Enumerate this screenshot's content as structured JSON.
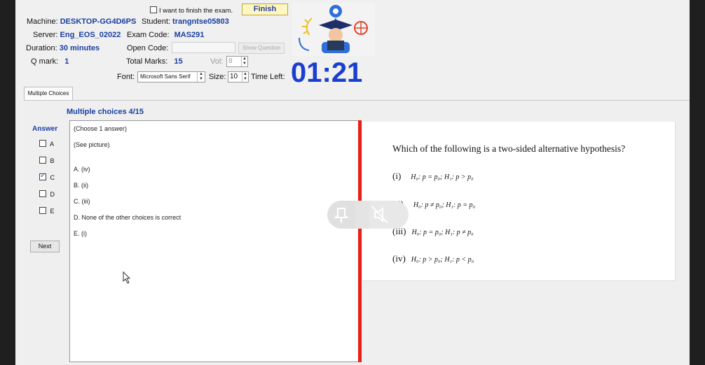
{
  "header": {
    "finish_checkbox_label": "I want to finish the exam.",
    "finish_button": "Finish",
    "machine_label": "Machine:",
    "machine_value": "DESKTOP-GG4D6PS",
    "student_label": "Student:",
    "student_value": "trangntse05803",
    "server_label": "Server:",
    "server_value": "Eng_EOS_02022",
    "exam_code_label": "Exam Code:",
    "exam_code_value": "MAS291",
    "duration_label": "Duration:",
    "duration_value": "30 minutes",
    "open_code_label": "Open Code:",
    "show_question_button": "Show Question",
    "qmark_label": "Q mark:",
    "qmark_value": "1",
    "total_marks_label": "Total Marks:",
    "total_marks_value": "15",
    "vol_label": "Vol:",
    "vol_value": "8",
    "font_label": "Font:",
    "font_value": "Microsoft Sans Serif",
    "size_label": "Size:",
    "size_value": "10",
    "time_left_label": "Time Left:",
    "timer": "01:21"
  },
  "tabs": [
    "Multiple Choices"
  ],
  "question": {
    "title": "Multiple choices 4/15",
    "answer_label": "Answer",
    "options": [
      {
        "letter": "A",
        "checked": false
      },
      {
        "letter": "B",
        "checked": false
      },
      {
        "letter": "C",
        "checked": true
      },
      {
        "letter": "D",
        "checked": false
      },
      {
        "letter": "E",
        "checked": false
      }
    ],
    "next_button": "Next",
    "text_lines": [
      "(Choose 1 answer)",
      "(See picture)",
      "A. (iv)",
      "B. (ii)",
      "C. (iii)",
      "D. None of the other choices is correct",
      "E. (i)"
    ]
  },
  "picture": {
    "question": "Which of the following is a two-sided alternative hypothesis?",
    "items": [
      {
        "num": "(i)",
        "hyp": "H₀: p = p₀; H₁: p > p₀"
      },
      {
        "num": "(ii)",
        "hyp": "H₀: p ≠ p₀; H₁: p = p₀"
      },
      {
        "num": "(iii)",
        "hyp": "H₀: p = p₀; H₁: p ≠ p₀"
      },
      {
        "num": "(iv)",
        "hyp": "H₀: p > p₀; H₁: p < p₀"
      }
    ]
  },
  "colors": {
    "accent": "#1a3fa0",
    "timer": "#1a3fd0",
    "splitter": "#e8201a",
    "finish_bg": "#fff7c2"
  }
}
